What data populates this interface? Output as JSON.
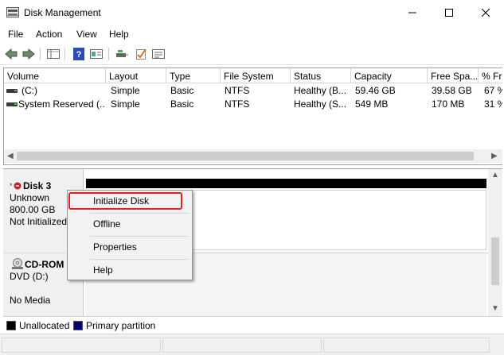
{
  "window": {
    "title": "Disk Management",
    "controls": {
      "minimize": "—",
      "maximize": "☐",
      "close": "✕"
    }
  },
  "menu": [
    "File",
    "Action",
    "View",
    "Help"
  ],
  "toolbar": [
    "back-icon",
    "forward-icon",
    "console-tree-icon",
    "help-icon",
    "properties-icon",
    "connect-disk-icon",
    "check-icon",
    "list-icon"
  ],
  "volume_table": {
    "columns": [
      "Volume",
      "Layout",
      "Type",
      "File System",
      "Status",
      "Capacity",
      "Free Spa...",
      "% Fr"
    ],
    "rows": [
      [
        "(C:)",
        "Simple",
        "Basic",
        "NTFS",
        "Healthy (B...",
        "59.46 GB",
        "39.58 GB",
        "67 %"
      ],
      [
        "System Reserved (...",
        "Simple",
        "Basic",
        "NTFS",
        "Healthy (S...",
        "549 MB",
        "170 MB",
        "31 %"
      ]
    ]
  },
  "disks": [
    {
      "name": "Disk 3",
      "lines": [
        "Unknown",
        "800.00 GB",
        "Not Initialized"
      ]
    },
    {
      "name": "CD-ROM",
      "lines": [
        "DVD (D:)",
        "",
        "No Media"
      ]
    }
  ],
  "context_menu": [
    "Initialize Disk",
    "Offline",
    "Properties",
    "Help"
  ],
  "legend": [
    {
      "label": "Unallocated",
      "color": "#000000"
    },
    {
      "label": "Primary partition",
      "color": "#00007f"
    }
  ],
  "colors": {
    "highlight": "#e0201c",
    "primary_partition": "#00007f"
  }
}
